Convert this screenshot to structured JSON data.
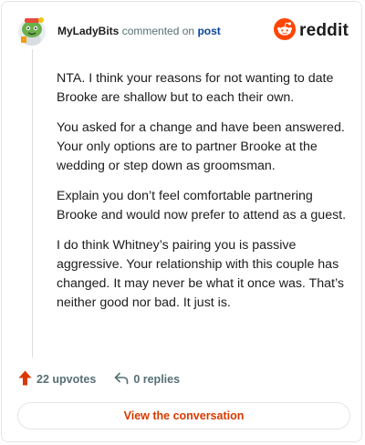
{
  "header": {
    "username": "MyLadyBits",
    "action_text": "commented on",
    "post_link": "post",
    "brand": "reddit"
  },
  "comment": {
    "paragraphs": [
      "NTA. I think your reasons for not wanting to date Brooke are shallow but to each their own.",
      "You asked for a change and have been answered. Your only options are to partner Brooke at the wedding or step down as groomsman.",
      "Explain you don’t feel comfortable partnering Brooke and would now prefer to attend as a guest.",
      "I do think Whitney’s pairing you is passive aggressive. Your relationship with this couple has changed. It may never be what it once was. That’s neither good nor bad. It just is."
    ]
  },
  "actions": {
    "upvotes": "22 upvotes",
    "replies": "0 replies"
  },
  "footer": {
    "view_button": "View the conversation"
  },
  "colors": {
    "accent": "#d93900",
    "link": "#0a449b",
    "reddit_orange": "#ff4500",
    "upvote": "#d93900"
  },
  "icons": {
    "avatar": "snoo-avatar-icon",
    "logo": "reddit-logo-icon",
    "upvote": "upvote-arrow-icon",
    "reply": "reply-arrow-icon"
  }
}
